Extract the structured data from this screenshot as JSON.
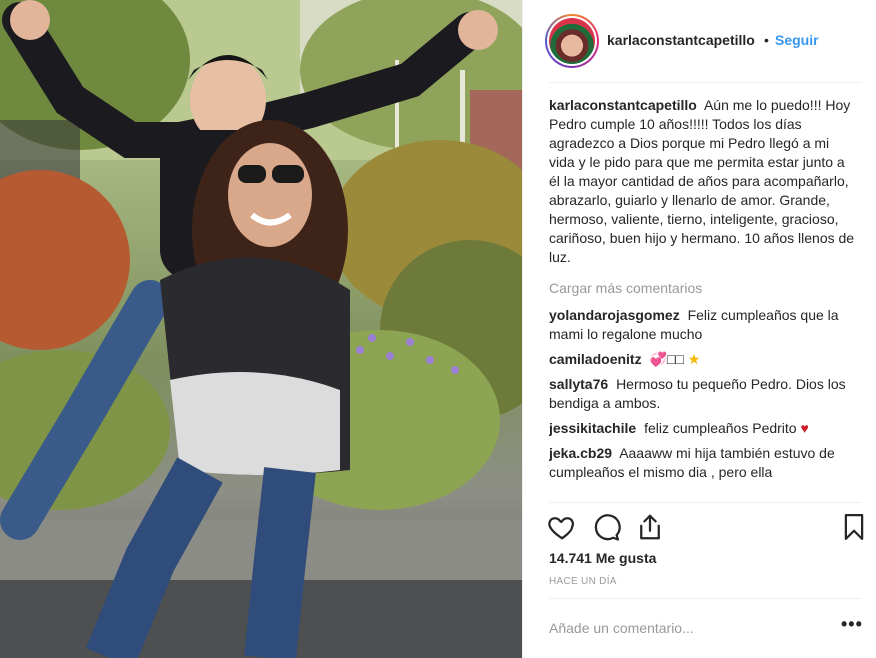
{
  "post": {
    "username": "karlaconstantcapetillo",
    "separator": "•",
    "follow_label": "Seguir",
    "caption": "Aún me lo puedo!!! Hoy Pedro cumple 10 años!!!!! Todos los días agradezco a Dios porque mi Pedro llegó a mi vida y le pido para que me permita estar junto a él la mayor cantidad de años para acompañarlo, abrazarlo, guiarlo y llenarlo de amor. Grande, hermoso, valiente, tierno, inteligente, gracioso, cariñoso, buen hijo y hermano. 10 años llenos de luz.",
    "load_more_label": "Cargar más comentarios",
    "comments": [
      {
        "user": "yolandarojasgomez",
        "text": "Feliz cumpleaños que la mami lo regalone mucho"
      },
      {
        "user": "camiladoenitz",
        "text": "💞□□",
        "emoji_tail": "★"
      },
      {
        "user": "sallyta76",
        "text": "Hermoso tu pequeño Pedro. Dios los bendiga a ambos."
      },
      {
        "user": "jessikitachile",
        "text": "feliz cumpleaños Pedrito",
        "emoji_tail": "♥"
      },
      {
        "user": "jeka.cb29",
        "text": "Aaaaww mi hija también estuvo de cumpleaños el mismo dia , pero ella"
      }
    ],
    "likes_label": "14.741 Me gusta",
    "time_label": "HACE UN DÍA",
    "add_comment_placeholder": "Añade un comentario...",
    "more_options_label": "•••"
  },
  "icons": {
    "like": "heart-outline-icon",
    "comment": "speech-bubble-icon",
    "share": "share-icon",
    "save": "bookmark-icon"
  },
  "colors": {
    "link_blue": "#3897f0",
    "text": "#262626",
    "muted": "#999999",
    "divider": "#efefef"
  }
}
